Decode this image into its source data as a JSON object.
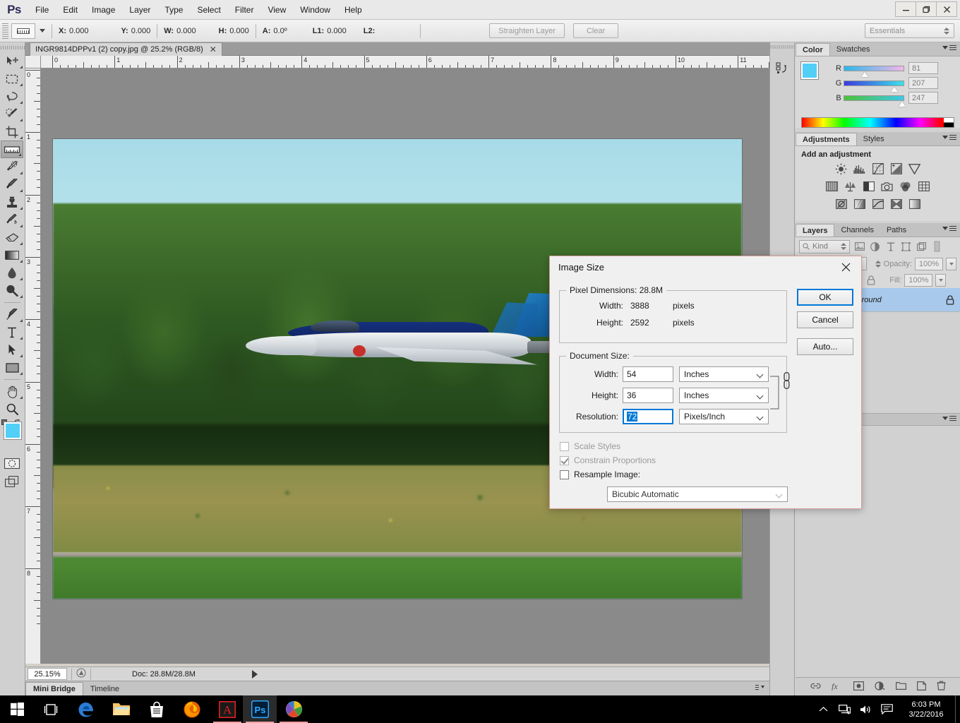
{
  "app": {
    "logo": "Ps",
    "title": "Adobe Photoshop"
  },
  "menubar": {
    "items": [
      {
        "label": "File"
      },
      {
        "label": "Edit"
      },
      {
        "label": "Image"
      },
      {
        "label": "Layer"
      },
      {
        "label": "Type"
      },
      {
        "label": "Select"
      },
      {
        "label": "Filter"
      },
      {
        "label": "View"
      },
      {
        "label": "Window"
      },
      {
        "label": "Help"
      }
    ],
    "window_controls": {
      "minimize": "—",
      "restore": "❐",
      "close": "✕"
    }
  },
  "options_bar": {
    "tool_icon": "ruler-icon",
    "fields": [
      {
        "label": "X:",
        "value": "0.000"
      },
      {
        "label": "Y:",
        "value": "0.000"
      },
      {
        "label": "W:",
        "value": "0.000"
      },
      {
        "label": "H:",
        "value": "0.000"
      },
      {
        "label": "A:",
        "value": "0.0º"
      },
      {
        "label": "L1:",
        "value": "0.000"
      },
      {
        "label": "L2:",
        "value": ""
      }
    ],
    "straighten_button": "Straighten Layer",
    "clear_button": "Clear",
    "workspace": "Essentials"
  },
  "toolbar": {
    "tools": [
      {
        "name": "move-tool",
        "label": "Move Tool"
      },
      {
        "name": "rectangular-marquee-tool",
        "label": "Rectangular Marquee Tool"
      },
      {
        "name": "lasso-tool",
        "label": "Lasso Tool"
      },
      {
        "name": "quick-selection-tool",
        "label": "Quick Selection Tool"
      },
      {
        "name": "crop-tool",
        "label": "Crop Tool"
      },
      {
        "name": "ruler-tool",
        "label": "Ruler Tool",
        "selected": true
      },
      {
        "name": "spot-healing-brush-tool",
        "label": "Spot Healing Brush Tool"
      },
      {
        "name": "brush-tool",
        "label": "Brush Tool"
      },
      {
        "name": "clone-stamp-tool",
        "label": "Clone Stamp Tool"
      },
      {
        "name": "history-brush-tool",
        "label": "History Brush Tool"
      },
      {
        "name": "eraser-tool",
        "label": "Eraser Tool"
      },
      {
        "name": "gradient-tool",
        "label": "Gradient Tool"
      },
      {
        "name": "blur-tool",
        "label": "Blur Tool"
      },
      {
        "name": "dodge-tool",
        "label": "Dodge Tool"
      },
      {
        "name": "pen-tool",
        "label": "Pen Tool"
      },
      {
        "name": "horizontal-type-tool",
        "label": "Horizontal Type Tool"
      },
      {
        "name": "path-selection-tool",
        "label": "Path Selection Tool"
      },
      {
        "name": "rectangle-tool",
        "label": "Rectangle Tool"
      },
      {
        "name": "hand-tool",
        "label": "Hand Tool"
      },
      {
        "name": "zoom-tool",
        "label": "Zoom Tool"
      }
    ],
    "foreground_color": "#51cff7",
    "background_color": "#ffffff"
  },
  "document": {
    "tab_title": "INGR9814DPPv1 (2) copy.jpg @ 25.2% (RGB/8)",
    "close_glyph": "✕",
    "ruler_units": "inches",
    "ruler_h_labels": [
      "0",
      "1",
      "2",
      "3",
      "4",
      "5",
      "6",
      "7",
      "8",
      "9",
      "10",
      "11"
    ],
    "ruler_v_labels": [
      "0",
      "1",
      "2",
      "3",
      "4",
      "5",
      "6",
      "7",
      "8"
    ],
    "canvas_image": "cf-18-hornet-fighter-jet-flying-low-over-treeline"
  },
  "status_bar": {
    "zoom": "25.15%",
    "doc_info": "Doc: 28.8M/28.8M"
  },
  "bottom_dock": {
    "tabs": [
      {
        "label": "Mini Bridge",
        "active": true
      },
      {
        "label": "Timeline",
        "active": false
      }
    ]
  },
  "color_panel": {
    "tabs": [
      {
        "label": "Color",
        "active": true
      },
      {
        "label": "Swatches",
        "active": false
      }
    ],
    "channels": [
      {
        "label": "R",
        "value": "81",
        "knob_pct": 32
      },
      {
        "label": "G",
        "value": "207",
        "knob_pct": 81
      },
      {
        "label": "B",
        "value": "247",
        "knob_pct": 95
      }
    ]
  },
  "adjustments_panel": {
    "tabs": [
      {
        "label": "Adjustments",
        "active": true
      },
      {
        "label": "Styles",
        "active": false
      }
    ],
    "title": "Add an adjustment",
    "rows": [
      [
        "brightness-contrast-icon",
        "levels-icon",
        "curves-icon",
        "exposure-icon",
        "vibrance-icon"
      ],
      [
        "hue-saturation-icon",
        "color-balance-icon",
        "black-white-icon",
        "photo-filter-icon",
        "channel-mixer-icon",
        "color-lookup-icon"
      ],
      [
        "invert-icon",
        "posterize-icon",
        "threshold-icon",
        "selective-color-icon",
        "gradient-map-icon"
      ]
    ]
  },
  "layers_panel": {
    "tabs": [
      {
        "label": "Layers",
        "active": true
      },
      {
        "label": "Channels",
        "active": false
      },
      {
        "label": "Paths",
        "active": false
      }
    ],
    "filter_kind": "Kind",
    "opacity_label": "Opacity:",
    "opacity_value": "100%",
    "fill_label": "Fill:",
    "fill_value": "100%",
    "layers": [
      {
        "name": "Background",
        "locked": true,
        "selected": true
      }
    ],
    "bottom_icons": [
      "link-icon",
      "fx-icon",
      "layer-mask-icon",
      "adjustment-layer-icon",
      "new-group-icon",
      "new-layer-icon",
      "delete-layer-icon"
    ]
  },
  "dialog": {
    "title": "Image Size",
    "close_glyph": "✕",
    "pixel_dimensions": {
      "legend": "Pixel Dimensions:  28.8M",
      "rows": [
        {
          "label": "Width:",
          "value": "3888",
          "unit": "pixels"
        },
        {
          "label": "Height:",
          "value": "2592",
          "unit": "pixels"
        }
      ]
    },
    "document_size": {
      "legend": "Document Size:",
      "rows": [
        {
          "label": "Width:",
          "value": "54",
          "unit": "Inches",
          "focused": false
        },
        {
          "label": "Height:",
          "value": "36",
          "unit": "Inches",
          "focused": false
        },
        {
          "label": "Resolution:",
          "value": "72",
          "unit": "Pixels/Inch",
          "focused": true
        }
      ]
    },
    "checkboxes": [
      {
        "label": "Scale Styles",
        "checked": false,
        "enabled": false
      },
      {
        "label": "Constrain Proportions",
        "checked": true,
        "enabled": false
      },
      {
        "label": "Resample Image:",
        "checked": false,
        "enabled": true
      }
    ],
    "resample_method": "Bicubic Automatic",
    "buttons": [
      {
        "label": "OK",
        "primary": true
      },
      {
        "label": "Cancel",
        "primary": false
      },
      {
        "label": "Auto...",
        "primary": false
      }
    ]
  },
  "taskbar": {
    "items": [
      {
        "name": "start-button",
        "label": "Start"
      },
      {
        "name": "task-view-button",
        "label": "Task View"
      },
      {
        "name": "edge-icon",
        "label": "Microsoft Edge"
      },
      {
        "name": "file-explorer-icon",
        "label": "File Explorer"
      },
      {
        "name": "store-icon",
        "label": "Microsoft Store"
      },
      {
        "name": "firefox-icon",
        "label": "Mozilla Firefox"
      },
      {
        "name": "acrobat-icon",
        "label": "Adobe Acrobat"
      },
      {
        "name": "photoshop-icon",
        "label": "Adobe Photoshop"
      },
      {
        "name": "picasa-icon",
        "label": "Picasa"
      }
    ],
    "tray": {
      "show_hidden": "chevron-up-icon",
      "network": "network-icon",
      "volume": "volume-icon",
      "action_center": "action-center-icon",
      "time": "6:03 PM",
      "date": "3/22/2016"
    }
  }
}
